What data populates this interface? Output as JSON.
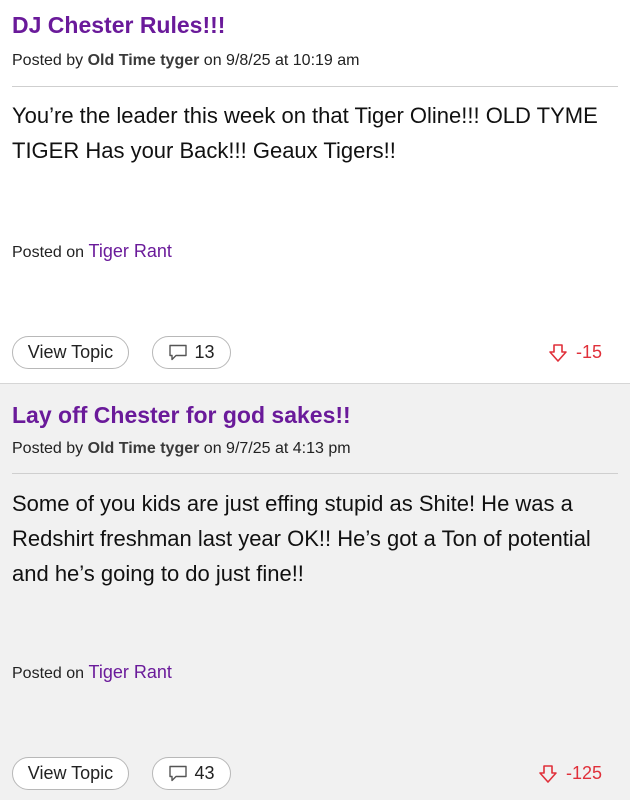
{
  "posts": [
    {
      "title": "DJ Chester Rules!!!",
      "posted_by_label": "Posted by",
      "author": "Old Time tyger",
      "on_label": "on",
      "timestamp": "9/8/25 at 10:19 am",
      "body": "You’re the leader this week on that Tiger Oline!!! OLD TYME TIGER Has your Back!!! Geaux Tigers!!",
      "posted_on_label": "Posted on",
      "board": "Tiger Rant",
      "view_topic_label": "View Topic",
      "comment_count": "13",
      "vote_score": "-15",
      "icons": {
        "comment": "comment-icon",
        "vote": "thumbs-down-icon"
      }
    },
    {
      "title": "Lay off Chester for god sakes!!",
      "posted_by_label": "Posted by",
      "author": "Old Time tyger",
      "on_label": "on",
      "timestamp": "9/7/25 at 4:13 pm",
      "body": "Some of you kids are just effing stupid as Shite! He was a Redshirt freshman last year OK!! He’s got a Ton of potential and he’s going to do just fine!!",
      "posted_on_label": "Posted on",
      "board": "Tiger Rant",
      "view_topic_label": "View Topic",
      "comment_count": "43",
      "vote_score": "-125",
      "icons": {
        "comment": "comment-icon",
        "vote": "thumbs-down-icon"
      }
    }
  ],
  "colors": {
    "title": "#6a1a9a",
    "board_link": "#6a1a9a",
    "negative_vote": "#e0303a",
    "alt_background": "#f1f1f1"
  }
}
